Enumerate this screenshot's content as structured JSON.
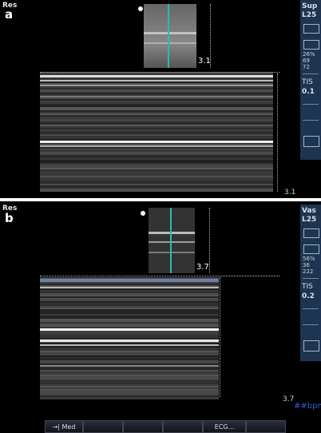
{
  "panel_a": {
    "label": "a",
    "mode": "Res",
    "probe_depth": "3.1",
    "mmode_depth": "3.1",
    "sidebar": {
      "preset": "Sup",
      "probe": "L25",
      "line1": "26%",
      "line2": "69",
      "line3": "72",
      "tis_label": "TIS",
      "tis_value": "0.1"
    }
  },
  "panel_b": {
    "label": "b",
    "mode": "Res",
    "probe_depth": "3.7",
    "mmode_depth": "3.7",
    "bpm": "##bpm",
    "sidebar": {
      "preset": "Vas",
      "probe": "L25",
      "line1": "56%",
      "line2": "36",
      "line3": "222",
      "tis_label": "TIS",
      "tis_value": "0.2"
    }
  },
  "menu": {
    "items": [
      "→| Med",
      "",
      "",
      "",
      "ECG...",
      ""
    ]
  },
  "colors": {
    "cursor": "#1fc3a8",
    "sidebar_bg": "#1d3550",
    "bpm_text": "#3a5ad8"
  }
}
